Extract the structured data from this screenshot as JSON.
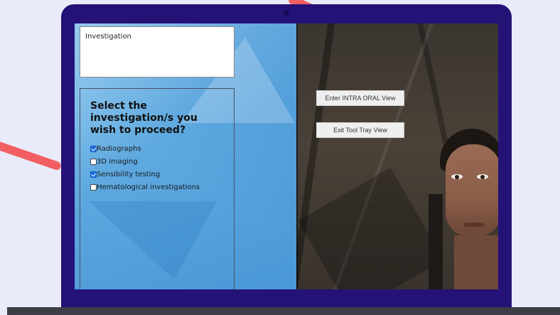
{
  "colors": {
    "laptop_frame": "#241277",
    "background": "#e9ebfa",
    "accent_stroke": "#f25f62",
    "checkbox_checked": "#1a73e8"
  },
  "info_box": {
    "label": "Investigation"
  },
  "investigation_form": {
    "question": "Select the investigation/s you wish to proceed?",
    "options": [
      {
        "label": "Radiographs",
        "checked": true
      },
      {
        "label": "3D imaging",
        "checked": false
      },
      {
        "label": "Sensibility testing",
        "checked": true
      },
      {
        "label": "Hematological investigations",
        "checked": false
      }
    ]
  },
  "vr_view": {
    "buttons": [
      {
        "label": "Enter INTRA ORAL View"
      },
      {
        "label": "Exit Tool Tray View"
      }
    ]
  }
}
